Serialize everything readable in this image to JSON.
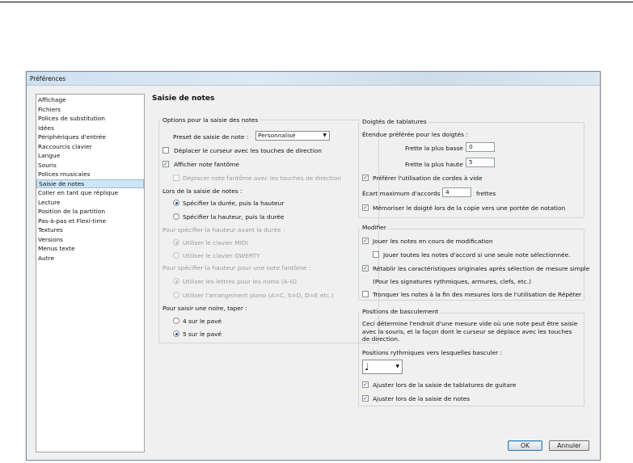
{
  "window": {
    "title": "Préférences"
  },
  "sidebar": {
    "items": [
      {
        "label": "Affichage"
      },
      {
        "label": "Fichiers"
      },
      {
        "label": "Polices de substitution"
      },
      {
        "label": "Idées"
      },
      {
        "label": "Périphériques d'entrée"
      },
      {
        "label": "Raccourcis clavier"
      },
      {
        "label": "Langue"
      },
      {
        "label": "Souris"
      },
      {
        "label": "Polices musicales"
      },
      {
        "label": "Saisie de notes",
        "selected": true
      },
      {
        "label": "Coller en tant que réplique"
      },
      {
        "label": "Lecture"
      },
      {
        "label": "Position de la partition"
      },
      {
        "label": "Pas-à-pas et Flexi-time"
      },
      {
        "label": "Textures"
      },
      {
        "label": "Versions"
      },
      {
        "label": "Menus texte"
      },
      {
        "label": "Autre"
      }
    ]
  },
  "page": {
    "title": "Saisie de notes"
  },
  "note_input": {
    "group_label": "Options pour la saisie des notes",
    "preset_label": "Preset de saisie de note :",
    "preset_value": "Personnalisé",
    "move_cursor_arrows": {
      "label": "Déplacer le curseur avec les touches de direction",
      "checked": false
    },
    "show_ghost_note": {
      "label": "Afficher note fantôme",
      "checked": true
    },
    "move_ghost_arrows": {
      "label": "Déplacer note fantôme avec les touches de direction",
      "checked": false
    },
    "during_input_label": "Lors de la saisie de notes :",
    "duration_then_pitch": {
      "label": "Spécifier la durée, puis la hauteur",
      "selected": true
    },
    "pitch_then_duration": {
      "label": "Spécifier la hauteur, puis la durée",
      "selected": false
    },
    "pitch_before_duration_label": "Pour spécifier la hauteur avant la durée :",
    "use_midi": {
      "label": "Utiliser le clavier MIDI",
      "selected": true
    },
    "use_qwerty": {
      "label": "Utiliser le clavier QWERTY",
      "selected": false
    },
    "ghost_pitch_label": "Pour spécifier la hauteur pour une note fantôme :",
    "use_letters": {
      "label": "Utiliser les lettres pour les noms (A-G)",
      "selected": true
    },
    "use_piano": {
      "label": "Utiliser l'arrangement piano (A=C, S=D, D=E etc.)",
      "selected": false
    },
    "quarter_label": "Pour saisir une noire, taper :",
    "four_keypad": {
      "label": "4 sur le pavé",
      "selected": false
    },
    "five_keypad": {
      "label": "5 sur le pavé",
      "selected": true
    }
  },
  "tab_fingering": {
    "group_label": "Doigtés de tablatures",
    "range_label": "Étendue préférée pour les doigtés :",
    "lowest_fret_label": "Frette la plus basse :",
    "lowest_fret_value": "0",
    "highest_fret_label": "Frette la plus haute :",
    "highest_fret_value": "5",
    "prefer_open": {
      "label": "Préférer l'utilisation de cordes à vide",
      "checked": true
    },
    "max_chord_label": "Écart maximum d'accords :",
    "max_chord_value": "4",
    "frets_label": "frettes",
    "remember_fingering": {
      "label": "Mémoriser le doigté lors de la copie vers une portée de notation",
      "checked": true
    }
  },
  "modify": {
    "group_label": "Modifier",
    "play_notes": {
      "label": "Jouer les notes en cours de modification",
      "checked": true
    },
    "play_chord": {
      "label": "Jouer toutes les notes d'accord si une seule note sélectionnée.",
      "checked": false
    },
    "restore_props": {
      "label": "Rétablir les caractéristiques originales après sélection de mesure simple",
      "checked": true
    },
    "restore_note": "(Pour les signatures rythmiques, armures, clefs, etc.)",
    "truncate_notes": {
      "label": "Tronquer les notes à la fin des mesures lors de l'utilisation de Répéter",
      "checked": false
    }
  },
  "snap": {
    "group_label": "Positions de basculement",
    "description": "Ceci détermine l'endroit d'une mesure vide où une note peut être saisie avec la souris, et la façon dont le curseur se déplace avec les touches de direction.",
    "positions_label": "Positions rythmiques vers lesquelles basculer :",
    "note_value": "♩",
    "adjust_tab": {
      "label": "Ajuster lors de la saisie de tablatures de guitare",
      "checked": true
    },
    "adjust_notes": {
      "label": "Ajuster lors de la saisie de notes",
      "checked": true
    }
  },
  "buttons": {
    "ok": "OK",
    "cancel": "Annuler"
  }
}
